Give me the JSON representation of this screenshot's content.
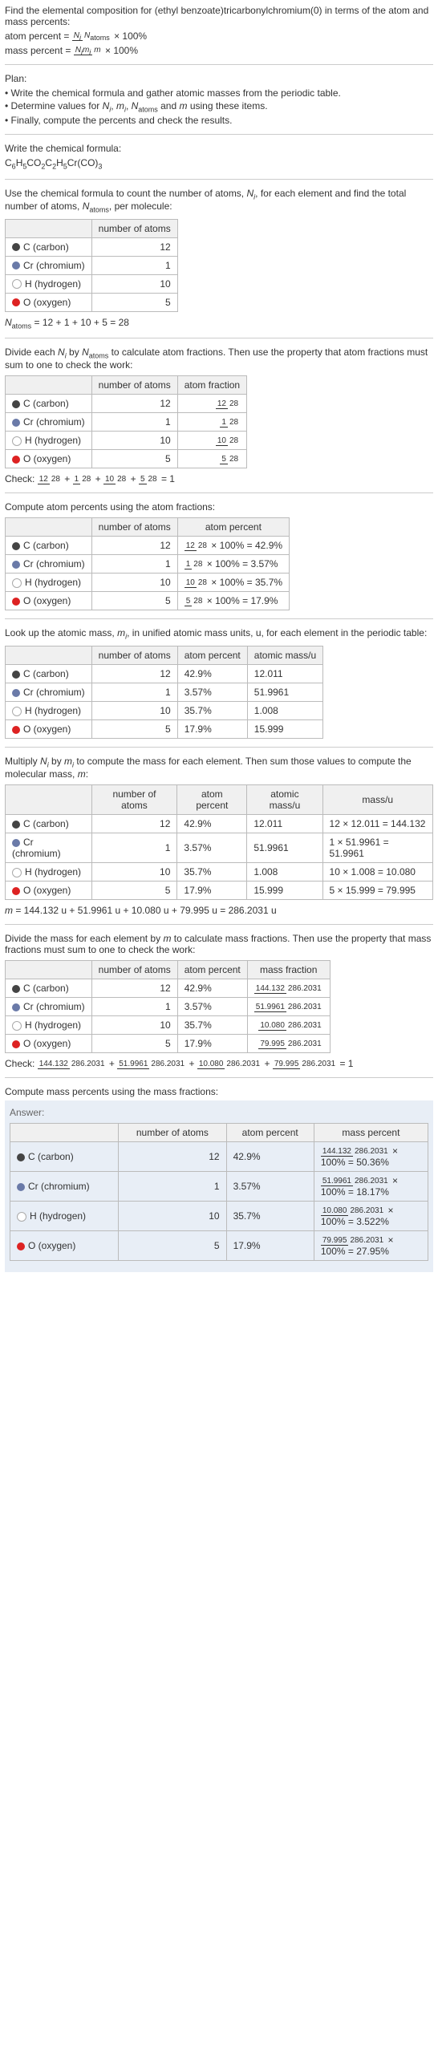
{
  "intro": {
    "line1": "Find the elemental composition for (ethyl benzoate)tricarbonylchromium(0) in terms of the atom and mass percents:",
    "atom_percent_label": "atom percent",
    "mass_percent_label": "mass percent",
    "atom_percent_formula_text": " × 100%",
    "mass_percent_formula_text": " × 100%"
  },
  "plan": {
    "header": "Plan:",
    "items": [
      "Write the chemical formula and gather atomic masses from the periodic table.",
      "Determine values for N_i, m_i, N_atoms and m using these items.",
      "Finally, compute the percents and check the results."
    ]
  },
  "chem_formula": {
    "header": "Write the chemical formula:",
    "display": "C6H5CO2C2H5Cr(CO)3",
    "c1": "C",
    "n1": "6",
    "h1": "H",
    "n2": "5",
    "c2": "CO",
    "n3": "2",
    "c3": "C",
    "n4": "2",
    "h2": "H",
    "n5": "5",
    "cr": "Cr(CO)",
    "n6": "3"
  },
  "table1": {
    "header": "Use the chemical formula to count the number of atoms, N_i, for each element and find the total number of atoms, N_atoms, per molecule:",
    "col_blank": " ",
    "col_num": "number of atoms",
    "rows": [
      {
        "dot": "c",
        "label": "C (carbon)",
        "n": "12"
      },
      {
        "dot": "cr",
        "label": "Cr (chromium)",
        "n": "1"
      },
      {
        "dot": "h",
        "label": "H (hydrogen)",
        "n": "10"
      },
      {
        "dot": "o",
        "label": "O (oxygen)",
        "n": "5"
      }
    ],
    "sum": "N_atoms = 12 + 1 + 10 + 5 = 28"
  },
  "table2": {
    "header": "Divide each N_i by N_atoms to calculate atom fractions. Then use the property that atom fractions must sum to one to check the work:",
    "col_num": "number of atoms",
    "col_frac": "atom fraction",
    "rows": [
      {
        "dot": "c",
        "label": "C (carbon)",
        "n": "12",
        "fn": "12",
        "fd": "28"
      },
      {
        "dot": "cr",
        "label": "Cr (chromium)",
        "n": "1",
        "fn": "1",
        "fd": "28"
      },
      {
        "dot": "h",
        "label": "H (hydrogen)",
        "n": "10",
        "fn": "10",
        "fd": "28"
      },
      {
        "dot": "o",
        "label": "O (oxygen)",
        "n": "5",
        "fn": "5",
        "fd": "28"
      }
    ],
    "check": "Check: ",
    "check_eq": " = 1"
  },
  "table3": {
    "header": "Compute atom percents using the atom fractions:",
    "col_num": "number of atoms",
    "col_pct": "atom percent",
    "rows": [
      {
        "dot": "c",
        "label": "C (carbon)",
        "n": "12",
        "fn": "12",
        "fd": "28",
        "pct": " × 100% = 42.9%"
      },
      {
        "dot": "cr",
        "label": "Cr (chromium)",
        "n": "1",
        "fn": "1",
        "fd": "28",
        "pct": " × 100% = 3.57%"
      },
      {
        "dot": "h",
        "label": "H (hydrogen)",
        "n": "10",
        "fn": "10",
        "fd": "28",
        "pct": " × 100% = 35.7%"
      },
      {
        "dot": "o",
        "label": "O (oxygen)",
        "n": "5",
        "fn": "5",
        "fd": "28",
        "pct": " × 100% = 17.9%"
      }
    ]
  },
  "table4": {
    "header": "Look up the atomic mass, m_i, in unified atomic mass units, u, for each element in the periodic table:",
    "col_num": "number of atoms",
    "col_pct": "atom percent",
    "col_mass": "atomic mass/u",
    "rows": [
      {
        "dot": "c",
        "label": "C (carbon)",
        "n": "12",
        "pct": "42.9%",
        "mass": "12.011"
      },
      {
        "dot": "cr",
        "label": "Cr (chromium)",
        "n": "1",
        "pct": "3.57%",
        "mass": "51.9961"
      },
      {
        "dot": "h",
        "label": "H (hydrogen)",
        "n": "10",
        "pct": "35.7%",
        "mass": "1.008"
      },
      {
        "dot": "o",
        "label": "O (oxygen)",
        "n": "5",
        "pct": "17.9%",
        "mass": "15.999"
      }
    ]
  },
  "table5": {
    "header": "Multiply N_i by m_i to compute the mass for each element. Then sum those values to compute the molecular mass, m:",
    "col_num": "number of atoms",
    "col_pct": "atom percent",
    "col_mass": "atomic mass/u",
    "col_total": "mass/u",
    "rows": [
      {
        "dot": "c",
        "label": "C (carbon)",
        "n": "12",
        "pct": "42.9%",
        "mass": "12.011",
        "total": "12 × 12.011 = 144.132"
      },
      {
        "dot": "cr",
        "label": "Cr (chromium)",
        "n": "1",
        "pct": "3.57%",
        "mass": "51.9961",
        "total": "1 × 51.9961 = 51.9961"
      },
      {
        "dot": "h",
        "label": "H (hydrogen)",
        "n": "10",
        "pct": "35.7%",
        "mass": "1.008",
        "total": "10 × 1.008 = 10.080"
      },
      {
        "dot": "o",
        "label": "O (oxygen)",
        "n": "5",
        "pct": "17.9%",
        "mass": "15.999",
        "total": "5 × 15.999 = 79.995"
      }
    ],
    "sum": "m = 144.132 u + 51.9961 u + 10.080 u + 79.995 u = 286.2031 u"
  },
  "table6": {
    "header": "Divide the mass for each element by m to calculate mass fractions. Then use the property that mass fractions must sum to one to check the work:",
    "col_num": "number of atoms",
    "col_pct": "atom percent",
    "col_mf": "mass fraction",
    "rows": [
      {
        "dot": "c",
        "label": "C (carbon)",
        "n": "12",
        "pct": "42.9%",
        "fn": "144.132",
        "fd": "286.2031"
      },
      {
        "dot": "cr",
        "label": "Cr (chromium)",
        "n": "1",
        "pct": "3.57%",
        "fn": "51.9961",
        "fd": "286.2031"
      },
      {
        "dot": "h",
        "label": "H (hydrogen)",
        "n": "10",
        "pct": "35.7%",
        "fn": "10.080",
        "fd": "286.2031"
      },
      {
        "dot": "o",
        "label": "O (oxygen)",
        "n": "5",
        "pct": "17.9%",
        "fn": "79.995",
        "fd": "286.2031"
      }
    ],
    "check": "Check: ",
    "check_eq": " = 1"
  },
  "table7": {
    "header": "Compute mass percents using the mass fractions:",
    "answer_label": "Answer:",
    "col_num": "number of atoms",
    "col_pct": "atom percent",
    "col_mp": "mass percent",
    "rows": [
      {
        "dot": "c",
        "label": "C (carbon)",
        "n": "12",
        "pct": "42.9%",
        "fn": "144.132",
        "fd": "286.2031",
        "mp": "100% = 50.36%"
      },
      {
        "dot": "cr",
        "label": "Cr (chromium)",
        "n": "1",
        "pct": "3.57%",
        "fn": "51.9961",
        "fd": "286.2031",
        "mp": "100% = 18.17%"
      },
      {
        "dot": "h",
        "label": "H (hydrogen)",
        "n": "10",
        "pct": "35.7%",
        "fn": "10.080",
        "fd": "286.2031",
        "mp": "100% = 3.522%"
      },
      {
        "dot": "o",
        "label": "O (oxygen)",
        "n": "5",
        "pct": "17.9%",
        "fn": "79.995",
        "fd": "286.2031",
        "mp": "100% = 27.95%"
      }
    ]
  },
  "chart_data": {
    "type": "table",
    "title": "Elemental composition of (ethyl benzoate)tricarbonylchromium(0)",
    "elements": [
      {
        "symbol": "C",
        "name": "carbon",
        "n_atoms": 12,
        "atom_fraction": "12/28",
        "atom_percent": 42.9,
        "atomic_mass_u": 12.011,
        "mass_u": 144.132,
        "mass_fraction": "144.132/286.2031",
        "mass_percent": 50.36
      },
      {
        "symbol": "Cr",
        "name": "chromium",
        "n_atoms": 1,
        "atom_fraction": "1/28",
        "atom_percent": 3.57,
        "atomic_mass_u": 51.9961,
        "mass_u": 51.9961,
        "mass_fraction": "51.9961/286.2031",
        "mass_percent": 18.17
      },
      {
        "symbol": "H",
        "name": "hydrogen",
        "n_atoms": 10,
        "atom_fraction": "10/28",
        "atom_percent": 35.7,
        "atomic_mass_u": 1.008,
        "mass_u": 10.08,
        "mass_fraction": "10.080/286.2031",
        "mass_percent": 3.522
      },
      {
        "symbol": "O",
        "name": "oxygen",
        "n_atoms": 5,
        "atom_fraction": "5/28",
        "atom_percent": 17.9,
        "atomic_mass_u": 15.999,
        "mass_u": 79.995,
        "mass_fraction": "79.995/286.2031",
        "mass_percent": 27.95
      }
    ],
    "N_atoms": 28,
    "m_u": 286.2031
  }
}
